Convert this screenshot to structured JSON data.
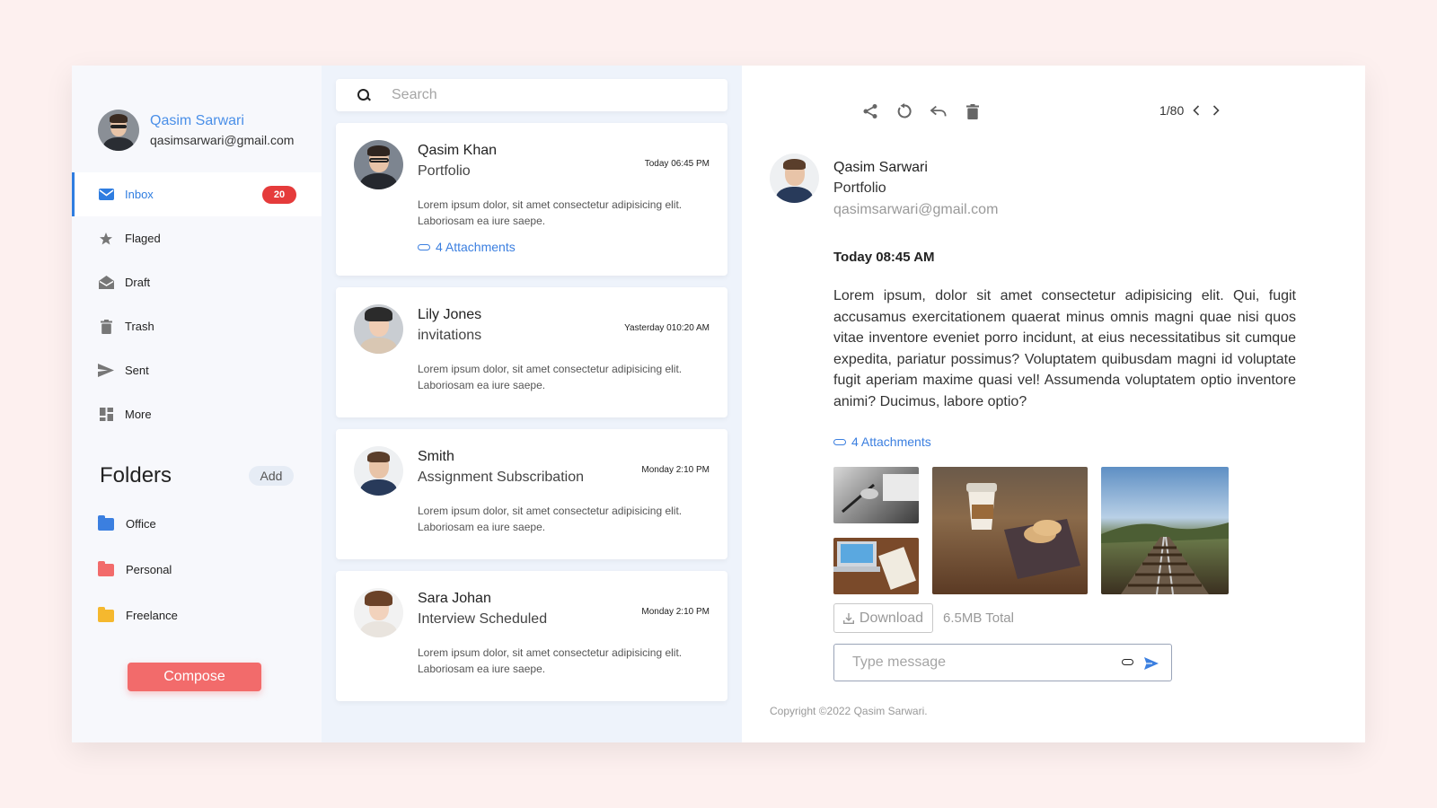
{
  "profile": {
    "name": "Qasim Sarwari",
    "email": "qasimsarwari@gmail.com"
  },
  "nav": [
    {
      "label": "Inbox",
      "icon": "mail-icon",
      "badge": "20",
      "active": true
    },
    {
      "label": "Flaged",
      "icon": "star-icon"
    },
    {
      "label": "Draft",
      "icon": "open-envelope-icon"
    },
    {
      "label": "Trash",
      "icon": "trash-icon"
    },
    {
      "label": "Sent",
      "icon": "send-icon"
    },
    {
      "label": "More",
      "icon": "grid-icon"
    }
  ],
  "folders": {
    "title": "Folders",
    "add_label": "Add",
    "items": [
      {
        "label": "Office",
        "color": "#3b7fe0"
      },
      {
        "label": "Personal",
        "color": "#f26b6b"
      },
      {
        "label": "Freelance",
        "color": "#f5b82e"
      }
    ]
  },
  "compose_label": "Compose",
  "search": {
    "placeholder": "Search"
  },
  "messages": [
    {
      "sender": "Qasim Khan",
      "subject": "Portfolio",
      "time": "Today 06:45 PM",
      "preview": "Lorem ipsum dolor, sit amet consectetur adipisicing elit. Laboriosam ea iure saepe.",
      "attachments": "4 Attachments"
    },
    {
      "sender": "Lily Jones",
      "subject": "invitations",
      "time": "Yasterday 010:20 AM",
      "preview": "Lorem ipsum dolor, sit amet consectetur adipisicing elit. Laboriosam ea iure saepe."
    },
    {
      "sender": "Smith",
      "subject": "Assignment Subscribation",
      "time": "Monday 2:10 PM",
      "preview": "Lorem ipsum dolor, sit amet consectetur adipisicing elit. Laboriosam ea iure saepe."
    },
    {
      "sender": "Sara Johan",
      "subject": "Interview Scheduled",
      "time": "Monday 2:10 PM",
      "preview": "Lorem ipsum dolor, sit amet consectetur adipisicing elit. Laboriosam ea iure saepe."
    }
  ],
  "reader": {
    "pager": "1/80",
    "sender": "Qasim Sarwari",
    "subject": "Portfolio",
    "email": "qasimsarwari@gmail.com",
    "date": "Today 08:45 AM",
    "body": "Lorem ipsum, dolor sit amet consectetur adipisicing elit. Qui, fugit accusamus exercitationem quaerat minus omnis magni quae nisi quos vitae inventore eveniet porro incidunt, at eius necessitatibus sit cumque expedita, pariatur possimus? Voluptatem quibusdam magni id voluptate fugit aperiam maxime quasi vel! Assumenda voluptatem optio inventore animi? Ducimus, labore optio?",
    "attachments": "4 Attachments",
    "download_label": "Download",
    "total": "6.5MB Total",
    "message_placeholder": "Type message"
  },
  "copyright": "Copyright ©2022 Qasim Sarwari.",
  "colors": {
    "accent": "#3b7fe0",
    "compose": "#f26b6b",
    "badge": "#e53b3b",
    "background": "#fdf0ef"
  }
}
